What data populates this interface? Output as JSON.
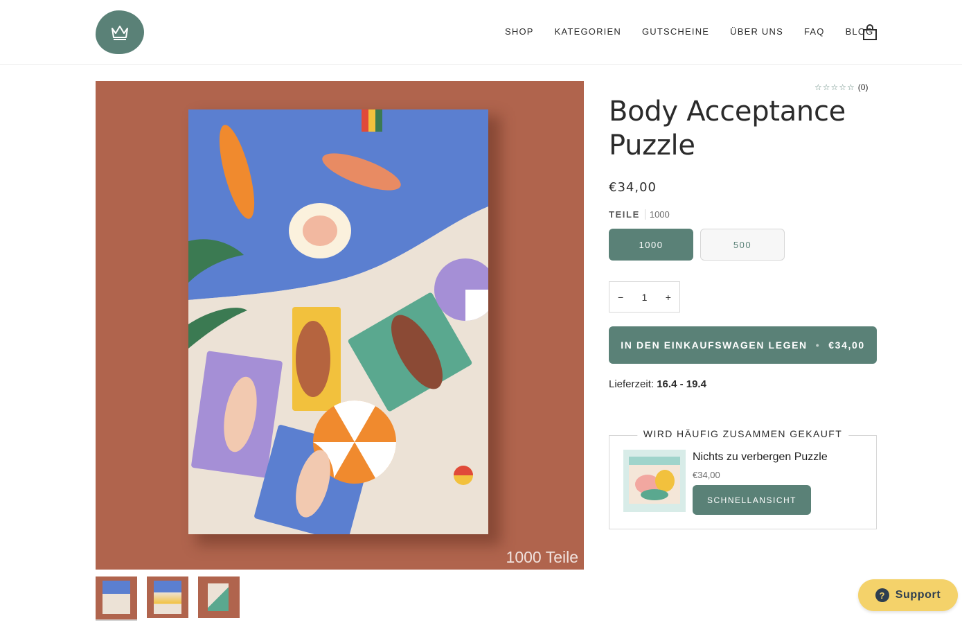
{
  "header": {
    "logo_icon": "crown-icon",
    "nav": [
      "SHOP",
      "KATEGORIEN",
      "GUTSCHEINE",
      "ÜBER UNS",
      "FAQ",
      "BLOG"
    ],
    "cart_icon": "shopping-bag-icon"
  },
  "gallery": {
    "image_caption": "1000 Teile",
    "thumbnail_count": 3,
    "active_thumbnail": 1
  },
  "product": {
    "rating": {
      "stars_filled": 0,
      "stars_total": 5,
      "count_text": "(0)"
    },
    "title": "Body Acceptance Puzzle",
    "price": "€34,00",
    "variant_label": "TEILE",
    "variant_selected_value": "1000",
    "variants": [
      "1000",
      "500"
    ],
    "quantity": "1",
    "qty_minus": "−",
    "qty_plus": "+",
    "add_to_cart_label": "IN DEN EINKAUFSWAGEN LEGEN",
    "add_to_cart_separator": "•",
    "add_to_cart_price": "€34,00",
    "delivery_label": "Lieferzeit:",
    "delivery_value": "16.4 - 19.4"
  },
  "bundle": {
    "title": "WIRD HÄUFIG ZUSAMMEN GEKAUFT",
    "item_name": "Nichts zu verbergen Puzzle",
    "item_price": "€34,00",
    "quickview_label": "SCHNELLANSICHT"
  },
  "support": {
    "label": "Support",
    "icon": "question-circle-icon"
  },
  "colors": {
    "brand": "#5a8177",
    "image_bg": "#b0644d",
    "support_bg": "#f4d26a"
  }
}
